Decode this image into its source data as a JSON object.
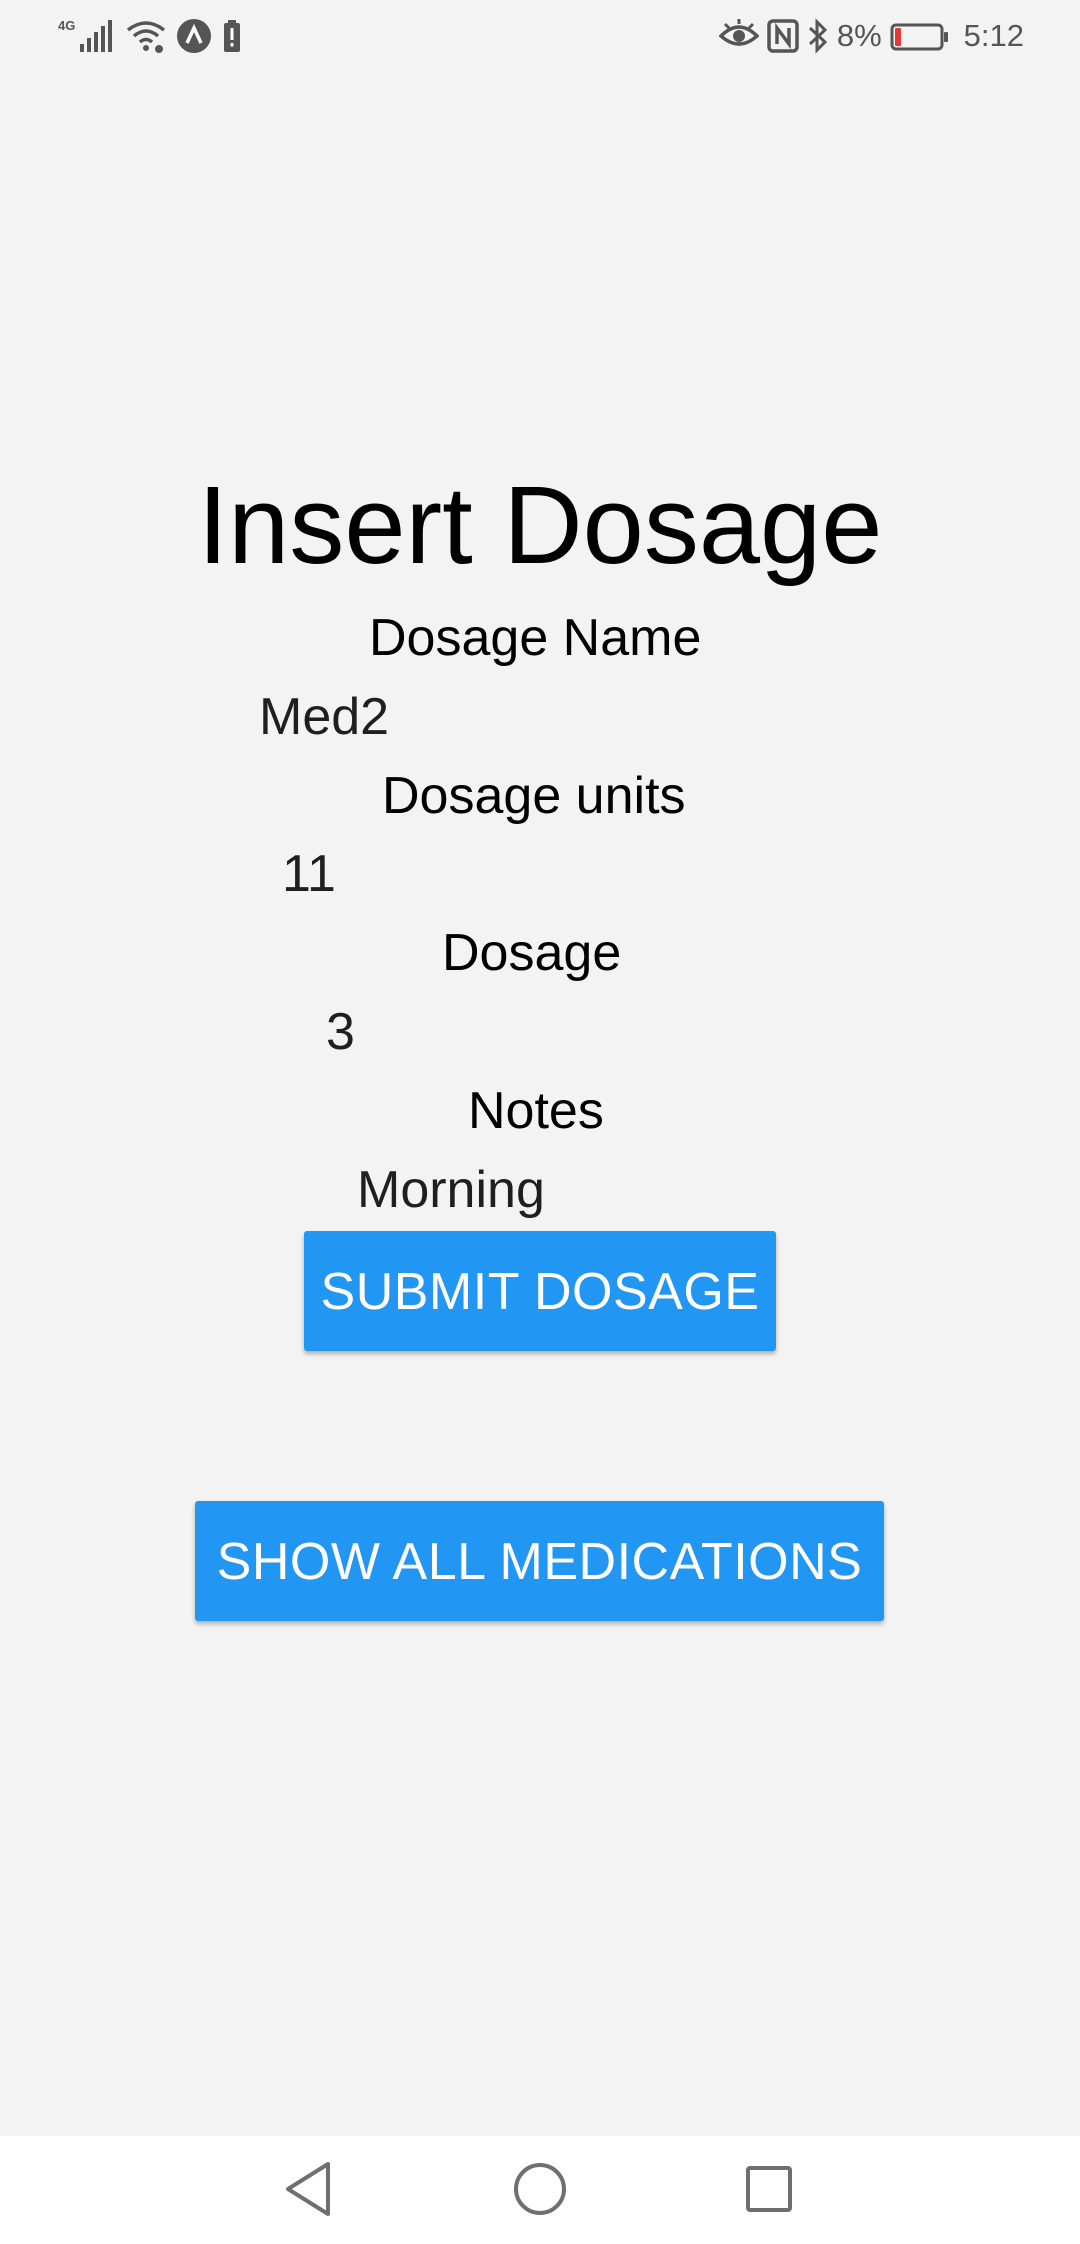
{
  "status_bar": {
    "network_type": "4G",
    "battery_percent": "8%",
    "time": "5:12",
    "icons_left": [
      "signal-icon",
      "wifi-icon",
      "app-notification-icon",
      "battery-alert-icon"
    ],
    "icons_right": [
      "eye-comfort-icon",
      "nfc-icon",
      "bluetooth-icon",
      "battery-icon"
    ]
  },
  "page": {
    "title": "Insert Dosage"
  },
  "form": {
    "dosage_name": {
      "label": "Dosage Name",
      "value": "Med2"
    },
    "dosage_units": {
      "label": "Dosage units",
      "value": "11"
    },
    "dosage": {
      "label": "Dosage",
      "value": "3"
    },
    "notes": {
      "label": "Notes",
      "value": "Morning"
    }
  },
  "buttons": {
    "submit_label": "SUBMIT DOSAGE",
    "show_all_label": "SHOW ALL MEDICATIONS"
  },
  "colors": {
    "accent": "#2196f3",
    "background": "#f3f3f3",
    "battery_low": "#e53935"
  },
  "nav_bar": {
    "items": [
      "back-icon",
      "home-icon",
      "recents-icon"
    ]
  }
}
